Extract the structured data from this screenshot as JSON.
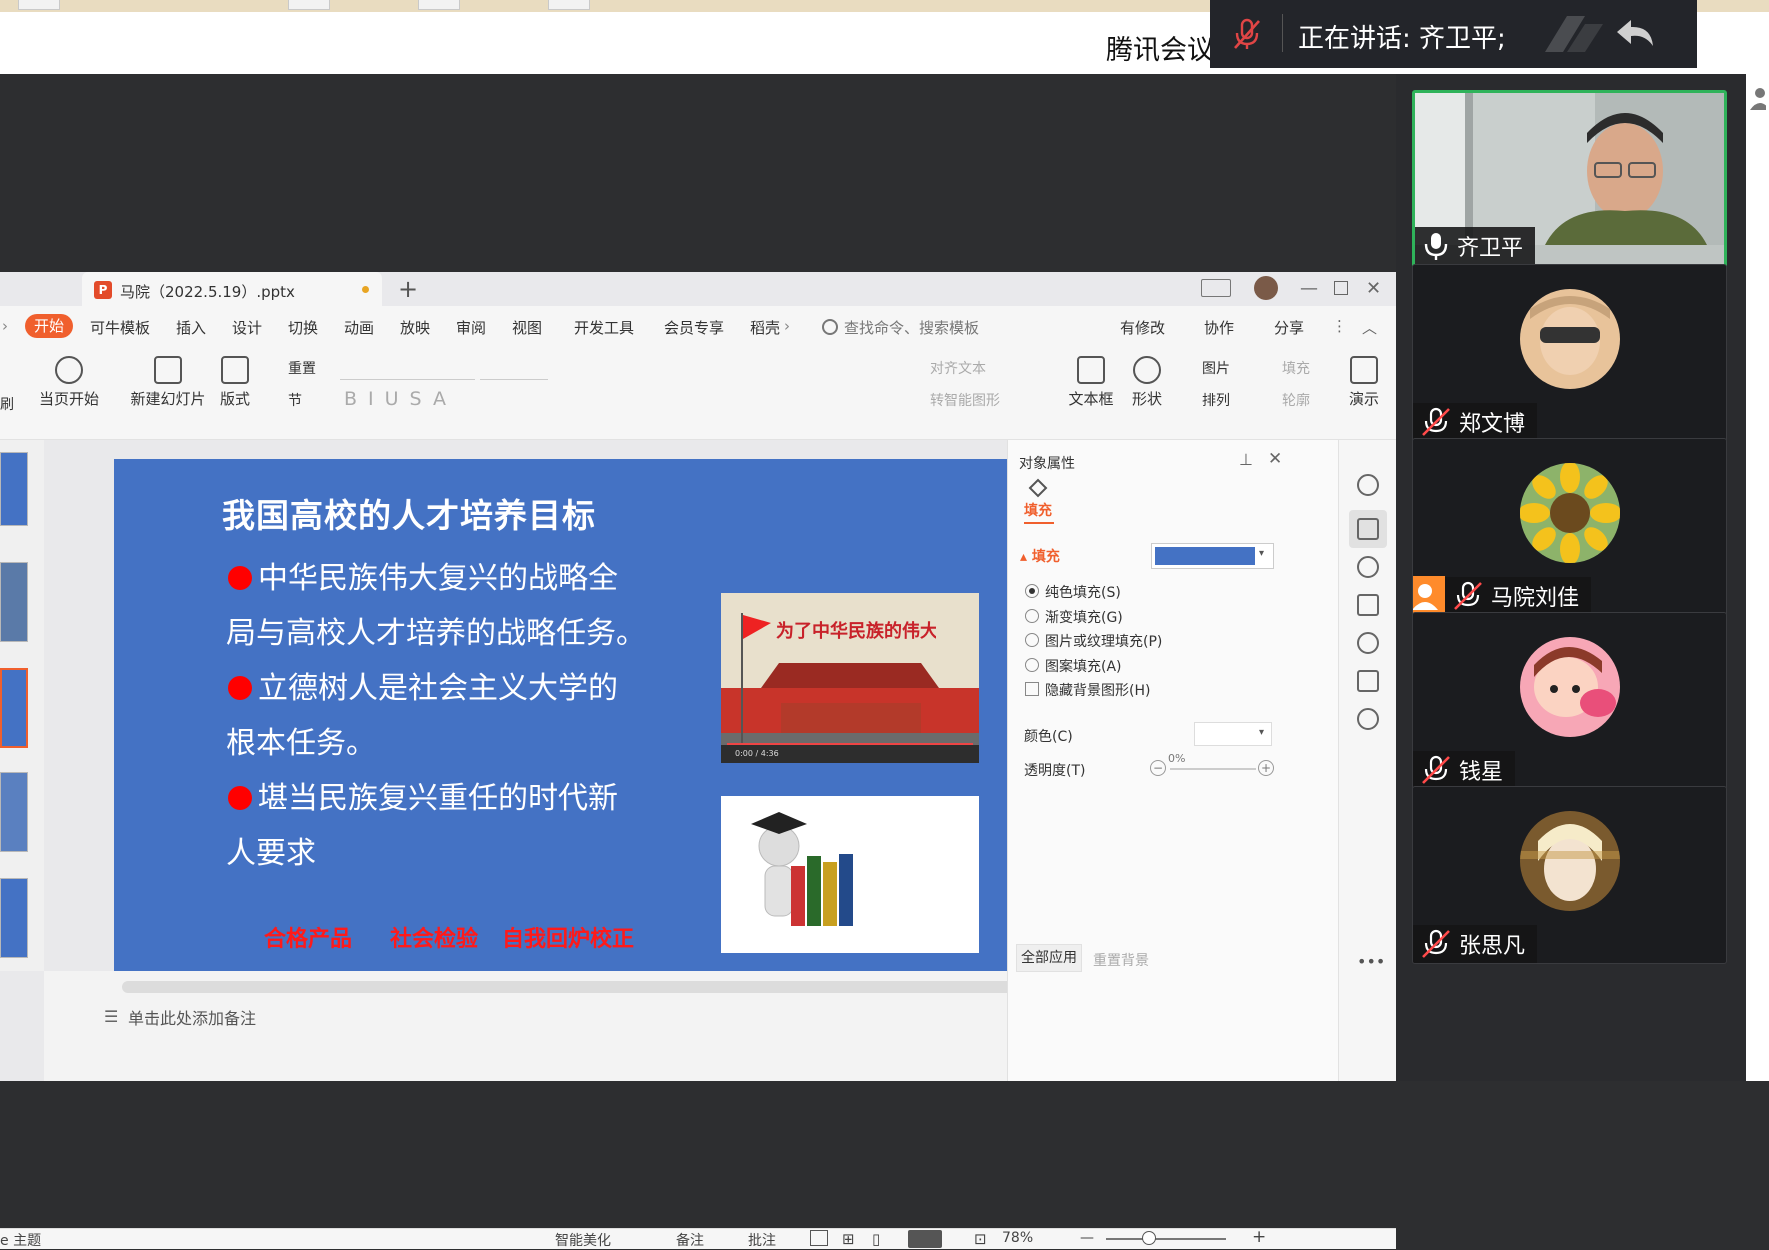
{
  "meeting": {
    "app_title": "腾讯会议",
    "speaker_label": "正在讲话: 齐卫平;"
  },
  "participants": [
    {
      "name": "齐卫平",
      "mic": "on",
      "active": true
    },
    {
      "name": "郑文博",
      "mic": "off",
      "active": false
    },
    {
      "name": "马院刘佳",
      "mic": "off",
      "active": false,
      "badge": "orange-user"
    },
    {
      "name": "钱星",
      "mic": "off",
      "active": false
    },
    {
      "name": "张思凡",
      "mic": "off",
      "active": false
    }
  ],
  "wps": {
    "doc_tab": "马院（2022.5.19）.pptx",
    "tab_icon": "P",
    "menu": [
      "开始",
      "可牛模板",
      "插入",
      "设计",
      "切换",
      "动画",
      "放映",
      "审阅",
      "视图",
      "开发工具",
      "会员专享",
      "稻壳"
    ],
    "search_placeholder": "查找命令、搜索模板",
    "right_menu": [
      "有修改",
      "协作",
      "分享"
    ],
    "toolbar": {
      "play_from_current": "当页开始",
      "new_slide": "新建幻灯片",
      "layout": "版式",
      "reset": "重置",
      "section": "节",
      "align_text": "对齐文本",
      "smart_graphic": "转智能图形",
      "textbox": "文本框",
      "shape": "形状",
      "picture": "图片",
      "arrange": "排列",
      "fill": "填充",
      "outline": "轮廓",
      "present": "演示",
      "left_cut": "刷"
    },
    "notes_placeholder": "单击此处添加备注",
    "status": {
      "theme": "e 主题",
      "beautify": "智能美化",
      "notes": "备注",
      "comments": "批注",
      "zoom": "78%"
    }
  },
  "slide": {
    "title": "我国高校的人才培养目标",
    "lines": [
      {
        "bullet": true,
        "text": "中华民族伟大复兴的战略全"
      },
      {
        "bullet": false,
        "text": "局与高校人才培养的战略任务。"
      },
      {
        "bullet": true,
        "text": "立德树人是社会主义大学的"
      },
      {
        "bullet": false,
        "text": "根本任务。"
      },
      {
        "bullet": true,
        "text": "堪当民族复兴重任的时代新"
      },
      {
        "bullet": false,
        "text": "人要求"
      }
    ],
    "keywords": [
      "合格产品",
      "社会检验",
      "自我回炉校正"
    ],
    "image1_caption": "为了中华民族的伟大复兴",
    "image1_time": "0:00 / 4:36"
  },
  "properties": {
    "header": "对象属性",
    "tab": "填充",
    "section": "填充",
    "fill_color": "#4472c4",
    "options": [
      {
        "label": "纯色填充(S)",
        "type": "radio",
        "checked": true
      },
      {
        "label": "渐变填充(G)",
        "type": "radio",
        "checked": false
      },
      {
        "label": "图片或纹理填充(P)",
        "type": "radio",
        "checked": false
      },
      {
        "label": "图案填充(A)",
        "type": "radio",
        "checked": false
      },
      {
        "label": "隐藏背景图形(H)",
        "type": "checkbox",
        "checked": false
      }
    ],
    "color_label": "颜色(C)",
    "transparency_label": "透明度(T)",
    "transparency_value": "0%",
    "apply_all": "全部应用",
    "reset_bg": "重置背景"
  },
  "colors": {
    "slide_blue": "#4472c4",
    "accent_orange": "#f05f2d",
    "active_green": "#2fb35a",
    "keyword_red": "#ff1a1a"
  }
}
